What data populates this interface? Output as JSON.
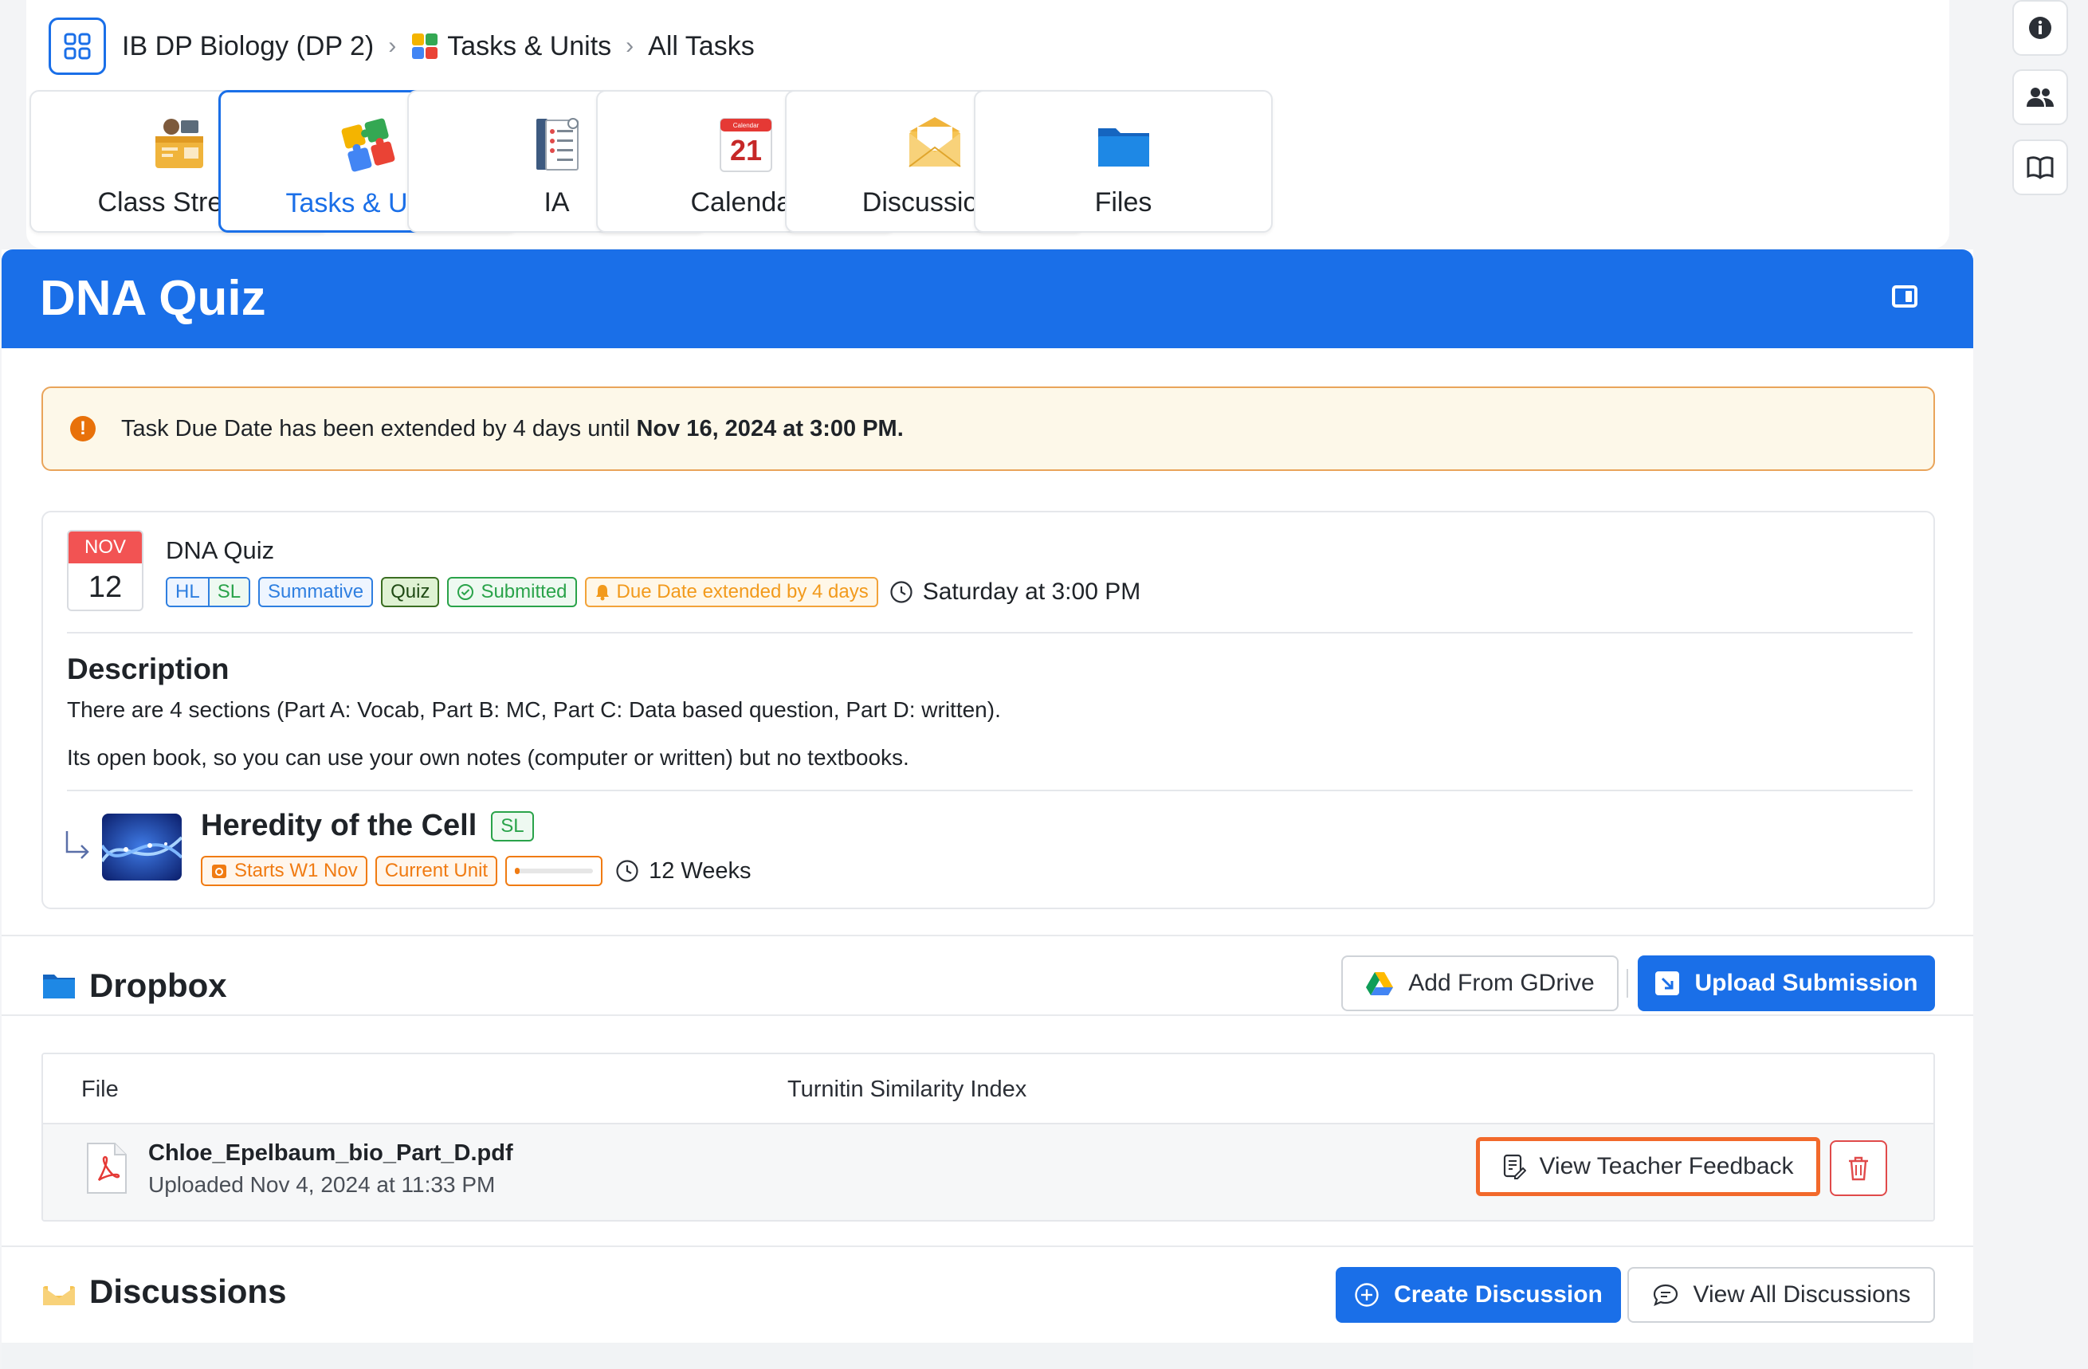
{
  "breadcrumb": {
    "course": "IB DP Biology (DP 2)",
    "section": "Tasks & Units",
    "page": "All Tasks"
  },
  "nav_tiles": [
    {
      "label": "Class Stream",
      "icon": "class-stream-icon"
    },
    {
      "label": "Tasks & Units",
      "icon": "puzzle-icon",
      "active": true
    },
    {
      "label": "IA",
      "icon": "ia-notebook-icon"
    },
    {
      "label": "Calendar",
      "icon": "calendar-icon",
      "day": "21",
      "header": "Calendar"
    },
    {
      "label": "Discussions",
      "icon": "envelope-icon"
    },
    {
      "label": "Files",
      "icon": "folder-icon"
    }
  ],
  "rail": [
    "info-icon",
    "people-icon",
    "book-icon"
  ],
  "task": {
    "title": "DNA Quiz",
    "alert_prefix": "Task Due Date has been extended by 4 days until ",
    "alert_bold": "Nov 16, 2024 at 3:00 PM.",
    "date_month": "NOV",
    "date_day": "12",
    "chips": {
      "hl": "HL",
      "sl": "SL",
      "summative": "Summative",
      "quiz": "Quiz",
      "submitted": "Submitted",
      "extended": "Due Date extended by 4 days"
    },
    "due_time": "Saturday at 3:00 PM",
    "description_heading": "Description",
    "description": [
      "There are 4 sections (Part A: Vocab, Part B: MC, Part C: Data based question, Part D: written).",
      "Its open book, so you can use your own notes (computer or written) but no textbooks."
    ]
  },
  "unit": {
    "title": "Heredity of the Cell",
    "level": "SL",
    "starts": "Starts W1 Nov",
    "status": "Current Unit",
    "progress": 0.05,
    "duration": "12 Weeks"
  },
  "dropbox": {
    "heading": "Dropbox",
    "gdrive_label": "Add From GDrive",
    "upload_label": "Upload Submission",
    "col_file": "File",
    "col_turnitin": "Turnitin Similarity Index",
    "files": [
      {
        "name": "Chloe_Epelbaum_bio_Part_D.pdf",
        "uploaded": "Uploaded Nov 4, 2024 at 11:33 PM"
      }
    ],
    "feedback_label": "View Teacher Feedback"
  },
  "discussions": {
    "heading": "Discussions",
    "create_label": "Create Discussion",
    "view_all_label": "View All Discussions"
  },
  "colors": {
    "accent": "#1a6fe8",
    "alert_bg": "#fdf8e9",
    "alert_border": "#e9a45a",
    "highlight": "#f2692b",
    "danger": "#e04a4a"
  }
}
